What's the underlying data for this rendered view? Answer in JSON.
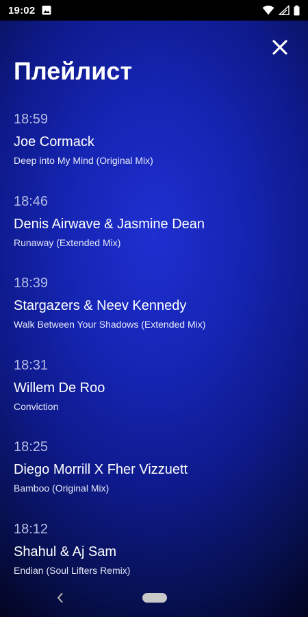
{
  "status_bar": {
    "time": "19:02",
    "icons": [
      "image-notification-icon",
      "wifi-icon",
      "cellular-signal-icon",
      "battery-icon"
    ]
  },
  "header": {
    "title": "Плейлист",
    "close_icon": "close-icon"
  },
  "playlist": {
    "tracks": [
      {
        "time": "18:59",
        "artist": "Joe Cormack",
        "title": "Deep into My Mind (Original Mix)"
      },
      {
        "time": "18:46",
        "artist": "Denis Airwave & Jasmine Dean",
        "title": "Runaway (Extended Mix)"
      },
      {
        "time": "18:39",
        "artist": "Stargazers & Neev Kennedy",
        "title": "Walk Between Your Shadows (Extended Mix)"
      },
      {
        "time": "18:31",
        "artist": "Willem De Roo",
        "title": "Conviction"
      },
      {
        "time": "18:25",
        "artist": "Diego Morrill X Fher Vizzuett",
        "title": "Bamboo (Original Mix)"
      },
      {
        "time": "18:12",
        "artist": "Shahul & Aj Sam",
        "title": "Endian (Soul Lifters Remix)"
      }
    ]
  },
  "nav_bar": {
    "back_icon": "back-chevron-icon",
    "home_icon": "home-pill-icon"
  },
  "colors": {
    "background_center": "#1f2fd0",
    "background_edge": "#02031a",
    "time_text": "#b8bde4",
    "primary_text": "#ffffff"
  }
}
